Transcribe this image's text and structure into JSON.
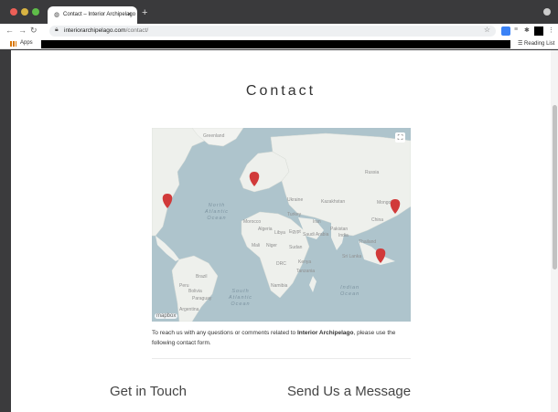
{
  "browser": {
    "tab_title": "Contact – Interior Archipelago",
    "tab_close": "×",
    "new_tab": "+",
    "url_domain": "interiorarchipelago.com",
    "url_path": "/contact/",
    "bookmarks": {
      "apps_label": "Apps",
      "reading_list": "Reading List"
    }
  },
  "page": {
    "title": "Contact",
    "map": {
      "place_labels": {
        "greenland": "Greenland",
        "russia": "Russia",
        "kazakhstan": "Kazakhstan",
        "mongolia": "Mongolia",
        "china": "China",
        "india": "India",
        "turkey": "Turkey",
        "iran": "Iran",
        "ukraine": "Ukraine",
        "egypt": "Egypt",
        "libya": "Libya",
        "algeria": "Algeria",
        "mali": "Mali",
        "niger": "Niger",
        "sudan": "Sudan",
        "brazil": "Brazil",
        "peru": "Peru",
        "bolivia": "Bolivia",
        "paraguay": "Paraguay",
        "argentina": "Argentina",
        "saudi": "Saudi Arabia",
        "pakistan": "Pakistan",
        "thailand": "Thailand",
        "morocco": "Morocco",
        "drc": "DRC",
        "kenya": "Kenya",
        "namibia": "Namibia",
        "sri_lanka": "Sri Lanka",
        "tanzania": "Tanzania"
      },
      "oceans": {
        "north_atlantic_1": "North",
        "north_atlantic_2": "Atlantic",
        "north_atlantic_3": "Ocean",
        "south_atlantic_1": "South",
        "south_atlantic_2": "Atlantic",
        "south_atlantic_3": "Ocean",
        "indian_1": "Indian",
        "indian_2": "Ocean"
      },
      "attribution": "mapbox",
      "fullscreen_icon": "⛶",
      "marker_color": "#d13a3a"
    },
    "intro_before": "To reach us with any questions or comments related to ",
    "intro_brand": "Interior Archipelago",
    "intro_after": ", please use the following contact form.",
    "section_left": "Get in Touch",
    "section_right": "Send Us a Message"
  }
}
